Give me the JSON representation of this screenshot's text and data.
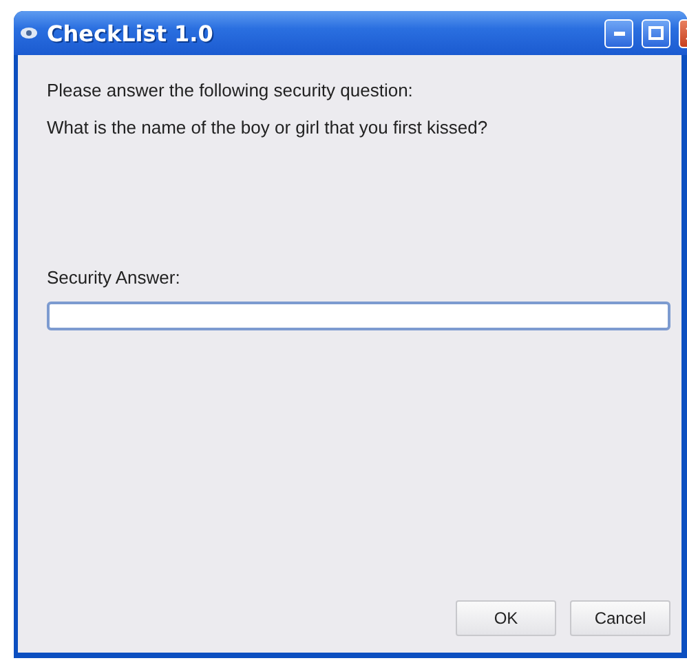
{
  "window": {
    "title": "CheckList 1.0"
  },
  "prompt": "Please answer the following security question:",
  "question": "What is the name of the boy or girl that you first kissed?",
  "answer": {
    "label": "Security Answer:"
  },
  "buttons": [
    "OK",
    "Cancel"
  ]
}
